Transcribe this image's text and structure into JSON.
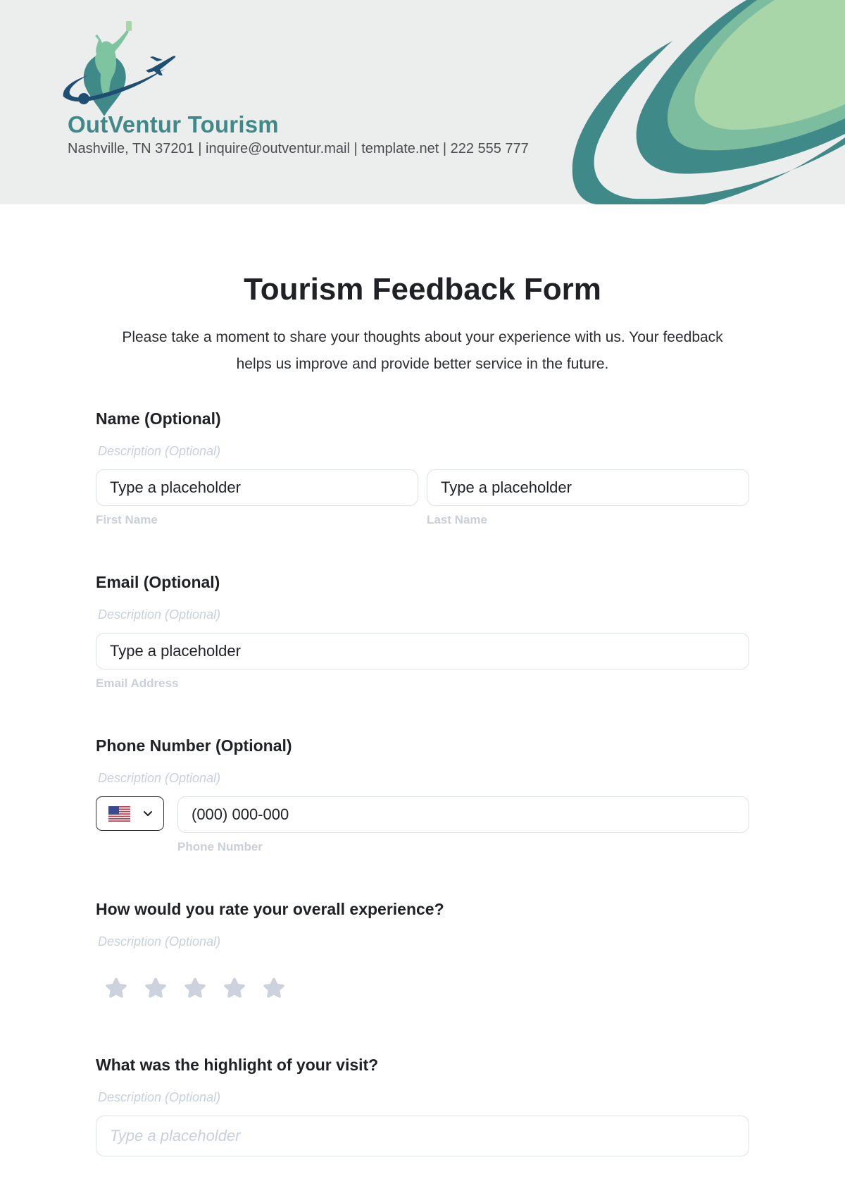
{
  "header": {
    "brand_name": "OutVentur Tourism",
    "contact_line": "Nashville, TN 37201 | inquire@outventur.mail | template.net | 222 555 777",
    "logo_icon": "travel-pin-plane-logo",
    "colors": {
      "teal": "#3f8a88",
      "mid_green": "#7bbd9e",
      "light_green": "#a9d6a8",
      "navy": "#1e4f72",
      "background": "#eceeed"
    }
  },
  "form": {
    "title": "Tourism Feedback Form",
    "intro": "Please take a moment to share your thoughts about your experience with us. Your feedback helps us improve and provide better service in the future.",
    "questions": [
      {
        "label": "Name (Optional)",
        "description": "Description (Optional)",
        "fields": [
          {
            "placeholder": "Type a placeholder",
            "sublabel": "First Name"
          },
          {
            "placeholder": "Type a placeholder",
            "sublabel": "Last Name"
          }
        ]
      },
      {
        "label": "Email (Optional)",
        "description": "Description (Optional)",
        "fields": [
          {
            "placeholder": "Type a placeholder",
            "sublabel": "Email Address"
          }
        ]
      },
      {
        "label": "Phone Number (Optional)",
        "description": "Description (Optional)",
        "country": {
          "selected": "US",
          "icon": "us-flag-icon"
        },
        "fields": [
          {
            "placeholder": "(000) 000-000",
            "sublabel": "Phone Number"
          }
        ]
      },
      {
        "label": "How would you rate your overall experience?",
        "description": "Description (Optional)",
        "rating": {
          "max": 5,
          "value": 0,
          "icon": "star-icon",
          "empty_color": "#cdd3dc"
        }
      },
      {
        "label": "What was the highlight of your visit?",
        "description": "Description (Optional)",
        "fields": [
          {
            "placeholder": "Type a placeholder"
          }
        ]
      }
    ]
  }
}
